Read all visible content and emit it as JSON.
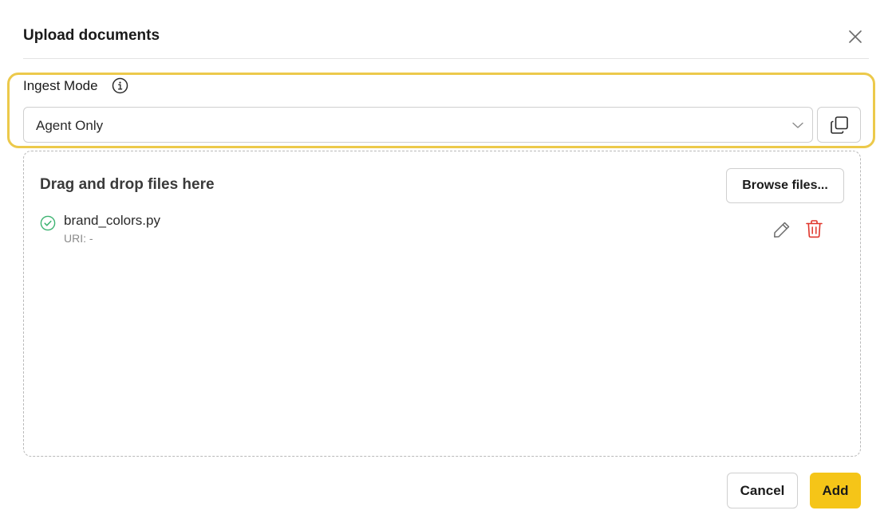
{
  "dialog": {
    "title": "Upload documents",
    "close_icon": "close-icon"
  },
  "ingest": {
    "label": "Ingest Mode",
    "info_icon": "info-icon",
    "selected": "Agent Only",
    "chevron_icon": "chevron-down-icon",
    "copy_icon": "copy-icon",
    "highlight_color": "#ecc94b"
  },
  "dropzone": {
    "title": "Drag and drop files here",
    "browse_label": "Browse files...",
    "files": [
      {
        "name": "brand_colors.py",
        "uri": "URI: -",
        "status_icon": "check-circle-icon",
        "status_color": "#3cb371"
      }
    ]
  },
  "footer": {
    "cancel_label": "Cancel",
    "add_label": "Add",
    "add_color": "#f5c518"
  },
  "colors": {
    "delete": "#e0352b"
  }
}
